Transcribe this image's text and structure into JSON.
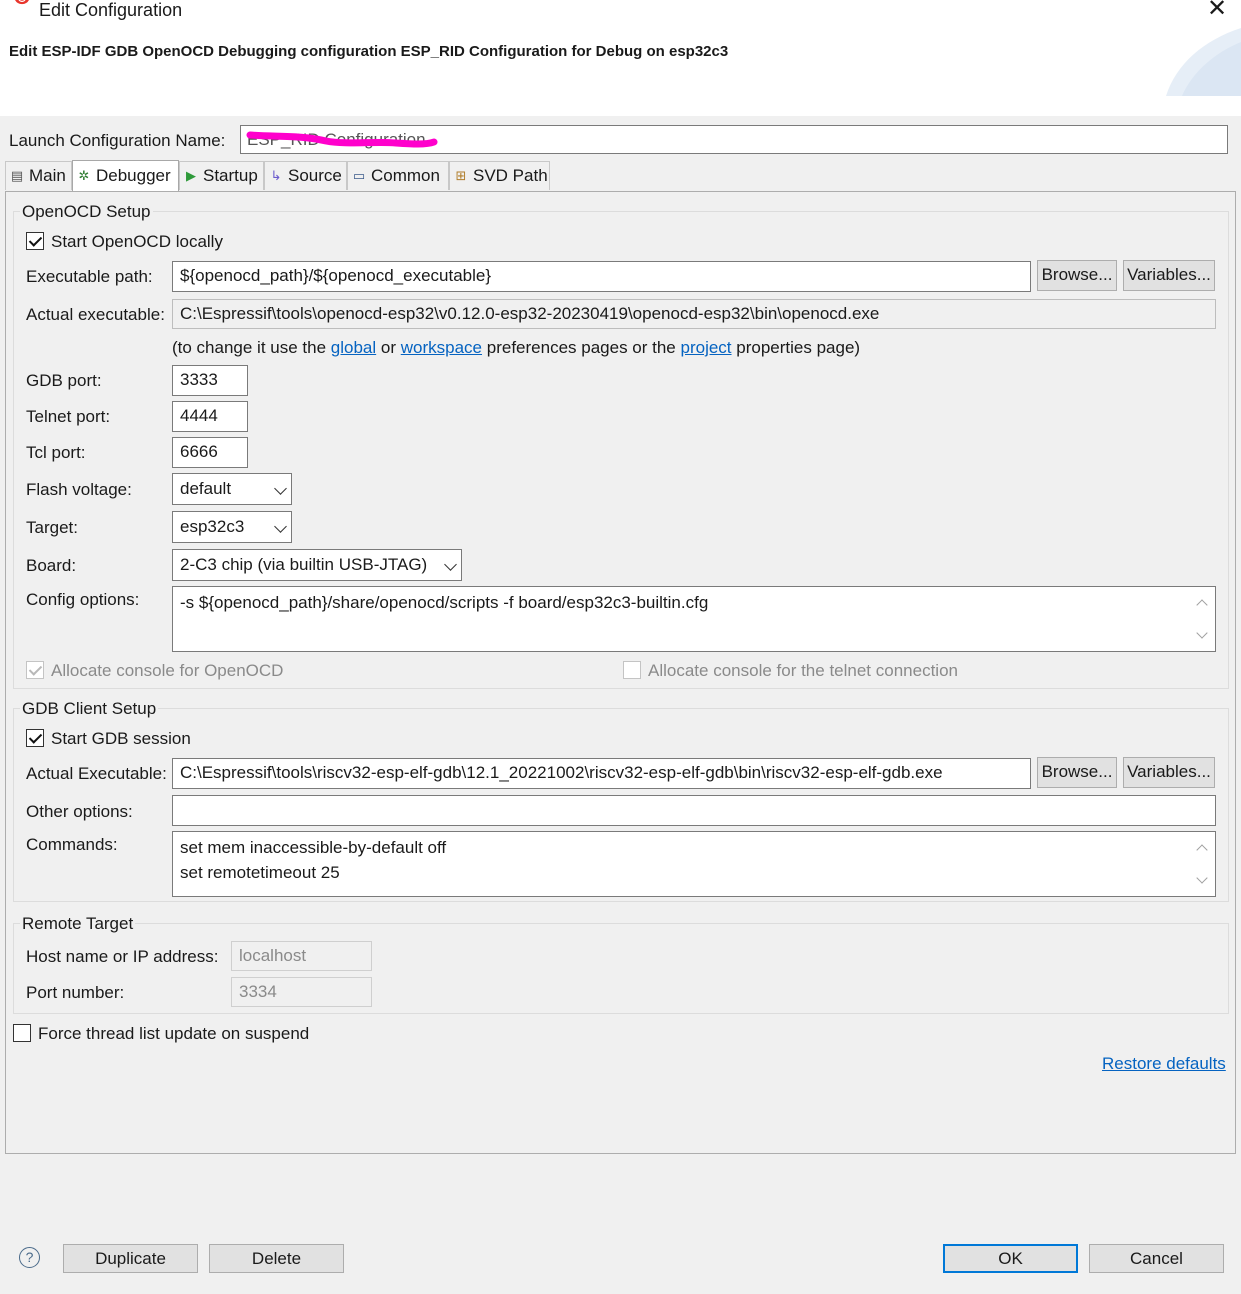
{
  "window": {
    "title": "Edit Configuration",
    "close_glyph": "✕",
    "icons": {
      "app": "espressif-app-icon",
      "close": "close-icon"
    }
  },
  "header": {
    "subtitle": "Edit ESP-IDF GDB OpenOCD Debugging configuration ESP_RID Configuration for Debug on esp32c3"
  },
  "launch": {
    "name_label": "Launch Configuration Name:",
    "name_value": "ESP_RID Configuration"
  },
  "tabs": [
    {
      "label": "Main",
      "icon": "document-icon",
      "glyph": "▤"
    },
    {
      "label": "Debugger",
      "icon": "debugger-bug-icon",
      "glyph": "✲"
    },
    {
      "label": "Startup",
      "icon": "play-icon",
      "glyph": "▶"
    },
    {
      "label": "Source",
      "icon": "source-icon",
      "glyph": "↳"
    },
    {
      "label": "Common",
      "icon": "common-icon",
      "glyph": "▭"
    },
    {
      "label": "SVD Path",
      "icon": "svd-tree-icon",
      "glyph": "⊞"
    }
  ],
  "active_tab": "Debugger",
  "openocd": {
    "group_title": "OpenOCD Setup",
    "start_locally_label": "Start OpenOCD locally",
    "start_locally_checked": true,
    "exec_path_label": "Executable path:",
    "exec_path_value": "${openocd_path}/${openocd_executable}",
    "browse_label": "Browse...",
    "variables_label": "Variables...",
    "actual_exec_label": "Actual executable:",
    "actual_exec_value": "C:\\Espressif\\tools\\openocd-esp32\\v0.12.0-esp32-20230419\\openocd-esp32\\bin\\openocd.exe",
    "hint_prefix": "(to change it use the",
    "hint_global": "global",
    "hint_or": "or",
    "hint_workspace": "workspace",
    "hint_middle": "preferences pages or the",
    "hint_project": "project",
    "hint_suffix": "properties page)",
    "gdb_port_label": "GDB port:",
    "gdb_port_value": "3333",
    "telnet_port_label": "Telnet port:",
    "telnet_port_value": "4444",
    "tcl_port_label": "Tcl port:",
    "tcl_port_value": "6666",
    "flash_voltage_label": "Flash voltage:",
    "flash_voltage_value": "default",
    "target_label": "Target:",
    "target_value": "esp32c3",
    "board_label": "Board:",
    "board_value": "2-C3 chip (via builtin USB-JTAG)",
    "config_options_label": "Config options:",
    "config_options_value": "-s ${openocd_path}/share/openocd/scripts -f board/esp32c3-builtin.cfg",
    "alloc_console_label": "Allocate console for OpenOCD",
    "alloc_console_checked": true,
    "alloc_telnet_label": "Allocate console for the telnet connection",
    "alloc_telnet_checked": false
  },
  "gdb_client": {
    "group_title": "GDB Client Setup",
    "start_session_label": "Start GDB session",
    "start_session_checked": true,
    "actual_exec_label": "Actual Executable:",
    "actual_exec_value": "C:\\Espressif\\tools\\riscv32-esp-elf-gdb\\12.1_20221002\\riscv32-esp-elf-gdb\\bin\\riscv32-esp-elf-gdb.exe",
    "browse_label": "Browse...",
    "variables_label": "Variables...",
    "other_options_label": "Other options:",
    "other_options_value": "",
    "commands_label": "Commands:",
    "commands_lines": [
      "set mem inaccessible-by-default off",
      "set remotetimeout 25"
    ]
  },
  "remote_target": {
    "group_title": "Remote Target",
    "host_label": "Host name or IP address:",
    "host_value": "localhost",
    "port_label": "Port number:",
    "port_value": "3334"
  },
  "force_thread_label": "Force thread list update on suspend",
  "force_thread_checked": false,
  "restore_defaults_label": "Restore defaults",
  "footer": {
    "help_glyph": "?",
    "duplicate_label": "Duplicate",
    "delete_label": "Delete",
    "ok_label": "OK",
    "cancel_label": "Cancel"
  },
  "colors": {
    "link": "#0563c1",
    "redaction": "#ff00cc",
    "default_button_border": "#0078d7"
  }
}
